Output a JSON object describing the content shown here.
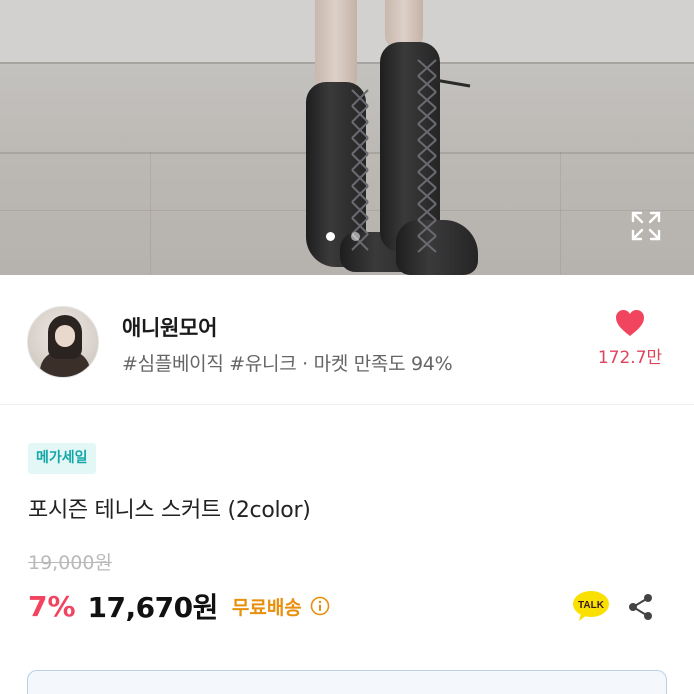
{
  "carousel": {
    "total": 2,
    "active": 0
  },
  "seller": {
    "name": "애니원모어",
    "tags": "#심플베이직 #유니크 · 마켓 만족도 94%",
    "like_count": "172.7만"
  },
  "product": {
    "badge": "메가세일",
    "title": "포시즌 테니스 스커트 (2color)",
    "original_price": "19,000원",
    "discount": "7%",
    "price": "17,670원",
    "shipping": "무료배송"
  },
  "talk_label": "TALK",
  "colors": {
    "accent_red": "#f0445f",
    "shipping_orange": "#e8900c",
    "badge_teal": "#14a6a6",
    "kakao_yellow": "#f9e000"
  },
  "icons": [
    "expand-icon",
    "heart-icon",
    "info-icon",
    "kakao-talk-icon",
    "share-icon"
  ]
}
